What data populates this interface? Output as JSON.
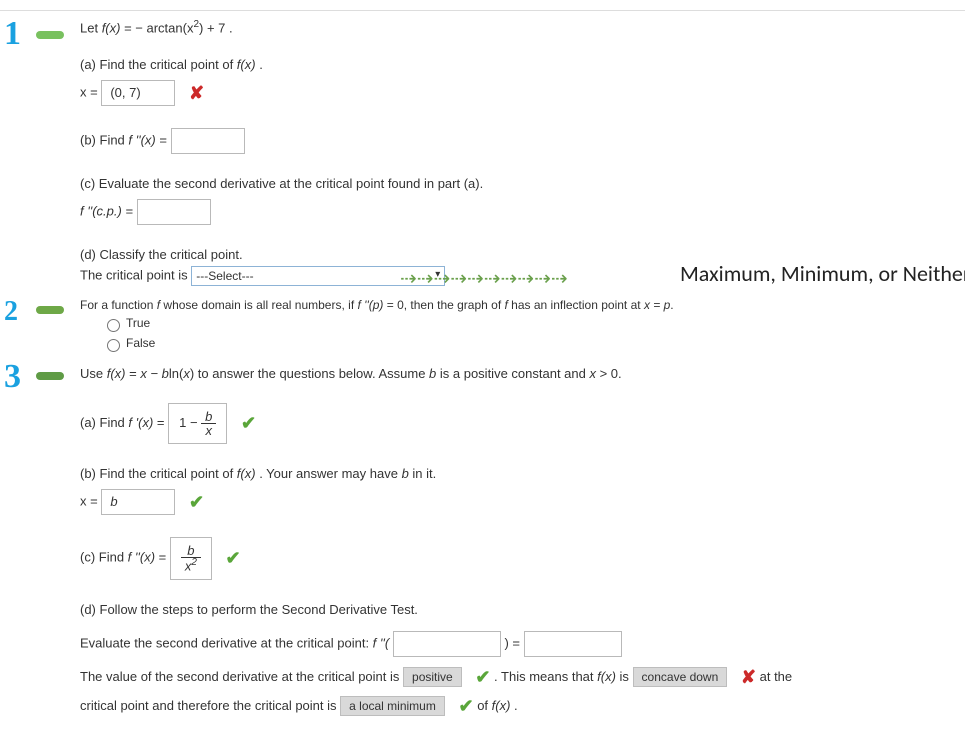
{
  "p1": {
    "intro_a": "Let ",
    "intro_b": "f(x)",
    "intro_c": " = − arctan(x",
    "intro_sup": "2",
    "intro_d": ") + 7 .",
    "a": {
      "q": "(a) Find the critical point of ",
      "fx": "f(x)",
      "q2": " .",
      "lbl": "x = ",
      "val": "(0, 7)"
    },
    "b": {
      "q": "(b) Find ",
      "fx": "f ''(x)",
      "eq": "  =  "
    },
    "c": {
      "q": "(c) Evaluate the second derivative at the critical point found in part (a).",
      "lbl": "f ''(c.p.)  =  "
    },
    "d": {
      "q": "(d) Classify the critical point.",
      "lead": "The critical point is ",
      "sel": "---Select---",
      "note": "Maximum, Minimum, or Neither"
    }
  },
  "p2": {
    "q_a": "For a function ",
    "q_b": "f",
    "q_c": " whose domain is all real numbers, if ",
    "q_d": "f ''(p)",
    "q_e": " = 0, then the graph of ",
    "q_f": "f",
    "q_g": " has an inflection point at ",
    "q_h": "x = p",
    "q_i": ".",
    "opt_t": "True",
    "opt_f": "False"
  },
  "p3": {
    "intro_a": "Use ",
    "intro_b": "f(x)",
    "intro_c": " = ",
    "intro_d": "x − b",
    "intro_e": "ln(",
    "intro_f": "x",
    "intro_g": ")  to answer the questions below. Assume ",
    "intro_h": "b",
    "intro_i": " is a positive constant and ",
    "intro_j": "x",
    "intro_k": " > 0.",
    "a": {
      "q": "(a) Find ",
      "fx": "f '(x)",
      "eq": "  =  ",
      "one": "1 − ",
      "num": "b",
      "den": "x"
    },
    "b": {
      "q": "(b) Find the critical point of ",
      "fx": "f(x)",
      "q2": " . Your answer may have ",
      "bi": "b",
      "q3": " in it.",
      "lbl": "x = ",
      "val": "b"
    },
    "c": {
      "q": "(c) Find ",
      "fx": "f ''(x)",
      "eq": "  =  ",
      "num": "b",
      "den_a": "x",
      "den_sup": "2"
    },
    "d": {
      "q": "(d) Follow the steps to perform the Second Derivative Test.",
      "e1": "Evaluate the second derivative at the critical point:  ",
      "fpp": "f ''(",
      "close": ")  =  ",
      "l1a": "The value of the second derivative at the critical point is ",
      "fill1": "positive",
      "l1b": " . This means that ",
      "fx": "f(x)",
      "l1c": " is ",
      "fill2": "concave down",
      "l1d": " at the",
      "l2a": "critical point and therefore the critical point is ",
      "fill3": "a local minimum",
      "l2b": " of ",
      "fx2": "f(x)",
      "l2c": " ."
    }
  }
}
